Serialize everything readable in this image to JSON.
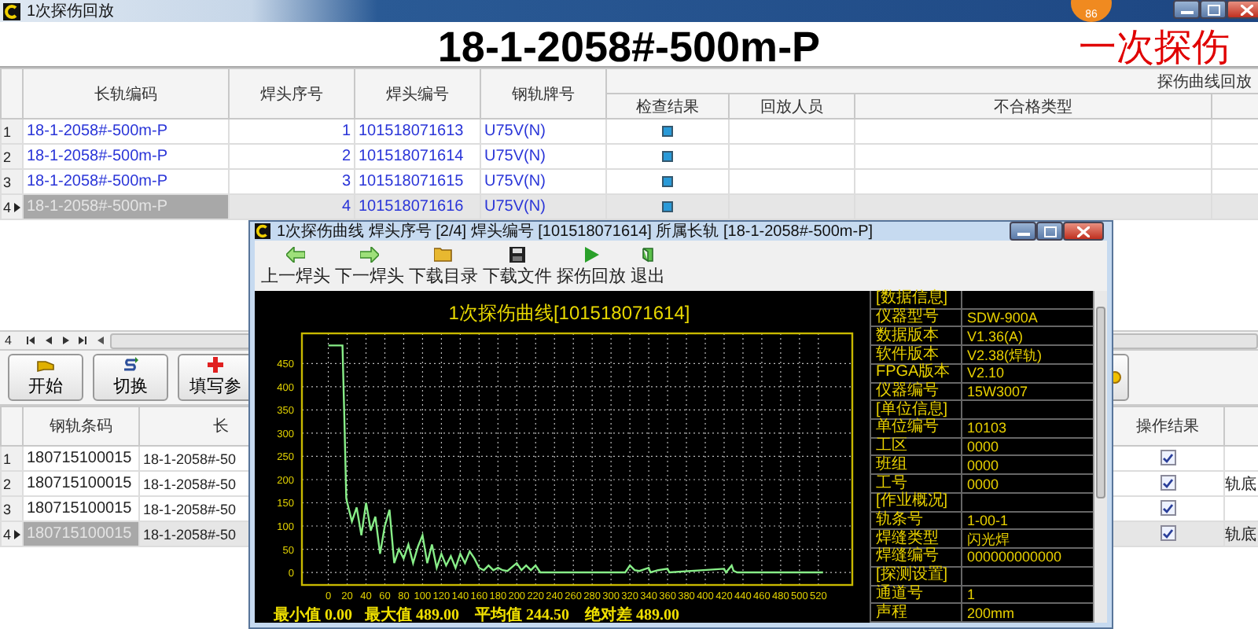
{
  "window": {
    "title": "1次探伤回放",
    "badge": "86"
  },
  "header": {
    "title": "18-1-2058#-500m-P",
    "subtitle": "一次探伤"
  },
  "upper_table": {
    "columns": [
      "长轨编码",
      "焊头序号",
      "焊头编号",
      "钢轨牌号"
    ],
    "group_title": "探伤曲线回放",
    "group_columns": [
      "检查结果",
      "回放人员",
      "不合格类型"
    ],
    "rows": [
      {
        "row": "1",
        "rail_code": "18-1-2058#-500m-P",
        "joint_seq": "1",
        "joint_no": "101518071613",
        "rail_grade": "U75V(N)",
        "selected": false
      },
      {
        "row": "2",
        "rail_code": "18-1-2058#-500m-P",
        "joint_seq": "2",
        "joint_no": "101518071614",
        "rail_grade": "U75V(N)",
        "selected": false
      },
      {
        "row": "3",
        "rail_code": "18-1-2058#-500m-P",
        "joint_seq": "3",
        "joint_no": "101518071615",
        "rail_grade": "U75V(N)",
        "selected": false
      },
      {
        "row": "4",
        "rail_code": "18-1-2058#-500m-P",
        "joint_seq": "4",
        "joint_no": "101518071616",
        "rail_grade": "U75V(N)",
        "selected": true
      }
    ]
  },
  "navigator": {
    "count": "4"
  },
  "toolbar": [
    "开始",
    "切换",
    "填写参"
  ],
  "lower_table": {
    "columns": [
      "钢轨条码",
      "长",
      "操作结果"
    ],
    "rows": [
      {
        "row": "1",
        "barcode": "180715100015",
        "rail": "18-1-2058#-50",
        "checked": true,
        "selected": false
      },
      {
        "row": "2",
        "barcode": "180715100015",
        "rail": "18-1-2058#-50",
        "checked": true,
        "note": "轨底",
        "selected": false
      },
      {
        "row": "3",
        "barcode": "180715100015",
        "rail": "18-1-2058#-50",
        "checked": true,
        "selected": false
      },
      {
        "row": "4",
        "barcode": "180715100015",
        "rail": "18-1-2058#-50",
        "checked": true,
        "note": "轨底",
        "selected": true
      }
    ]
  },
  "dialog": {
    "title": "1次探伤曲线  焊头序号 [2/4]  焊头编号 [101518071614]  所属长轨 [18-1-2058#-500m-P]",
    "tools": [
      "上一焊头",
      "下一焊头",
      "下载目录",
      "下载文件",
      "探伤回放",
      "退出"
    ],
    "chart_data": {
      "type": "line",
      "title": "1次探伤曲线[101518071614]",
      "grid": true,
      "xlim": [
        -28,
        556
      ],
      "ylim": [
        -27,
        515
      ],
      "xticks": [
        0,
        20,
        40,
        60,
        80,
        100,
        120,
        140,
        160,
        180,
        200,
        220,
        240,
        260,
        280,
        300,
        320,
        340,
        360,
        380,
        400,
        420,
        440,
        460,
        480,
        500,
        520
      ],
      "yticks": [
        0,
        50,
        100,
        150,
        200,
        250,
        300,
        350,
        400,
        450
      ],
      "x": [
        0,
        15,
        17,
        19,
        20,
        25,
        30,
        35,
        40,
        45,
        50,
        55,
        60,
        65,
        70,
        75,
        80,
        85,
        90,
        95,
        100,
        105,
        110,
        115,
        120,
        125,
        130,
        135,
        140,
        145,
        150,
        155,
        160,
        165,
        170,
        175,
        180,
        185,
        190,
        200,
        205,
        210,
        215,
        220,
        225,
        230,
        315,
        320,
        325,
        330,
        340,
        342,
        350,
        360,
        362,
        420,
        422,
        428,
        430,
        434,
        525
      ],
      "series": [
        {
          "color": "#88ee88",
          "values": [
            489,
            489,
            330,
            160,
            150,
            110,
            140,
            80,
            150,
            90,
            120,
            40,
            100,
            135,
            20,
            50,
            30,
            60,
            20,
            55,
            80,
            20,
            60,
            10,
            40,
            15,
            35,
            10,
            40,
            20,
            45,
            30,
            10,
            5,
            15,
            5,
            10,
            5,
            3,
            20,
            5,
            15,
            5,
            15,
            0,
            0,
            0,
            15,
            5,
            3,
            10,
            0,
            5,
            8,
            0,
            8,
            0,
            15,
            3,
            0,
            0
          ]
        }
      ]
    },
    "stats": [
      "最小值 0.00",
      "最大值 489.00",
      "平均值 244.50",
      "绝对差 489.00"
    ],
    "info": [
      {
        "kind": "section",
        "label": "[数据信息]"
      },
      {
        "kind": "field",
        "label": "仪器型号",
        "value": "SDW-900A"
      },
      {
        "kind": "field",
        "label": "数据版本",
        "value": "V1.36(A)"
      },
      {
        "kind": "field",
        "label": "软件版本",
        "value": "V2.38(焊轨)"
      },
      {
        "kind": "field",
        "label": "FPGA版本",
        "value": "V2.10"
      },
      {
        "kind": "field",
        "label": "仪器编号",
        "value": "15W3007"
      },
      {
        "kind": "section",
        "label": "[单位信息]"
      },
      {
        "kind": "field",
        "label": "单位编号",
        "value": "10103"
      },
      {
        "kind": "field",
        "label": "工区",
        "value": "0000"
      },
      {
        "kind": "field",
        "label": "班组",
        "value": "0000"
      },
      {
        "kind": "field",
        "label": "工号",
        "value": "0000"
      },
      {
        "kind": "section",
        "label": "[作业概况]"
      },
      {
        "kind": "field",
        "label": "轨条号",
        "value": "1-00-1"
      },
      {
        "kind": "field",
        "label": "焊缝类型",
        "value": "闪光焊"
      },
      {
        "kind": "field",
        "label": "焊缝编号",
        "value": "000000000000"
      },
      {
        "kind": "section",
        "label": "[探测设置]"
      },
      {
        "kind": "field",
        "label": "通道号",
        "value": "1"
      },
      {
        "kind": "field",
        "label": "声程",
        "value": "200mm"
      }
    ]
  }
}
